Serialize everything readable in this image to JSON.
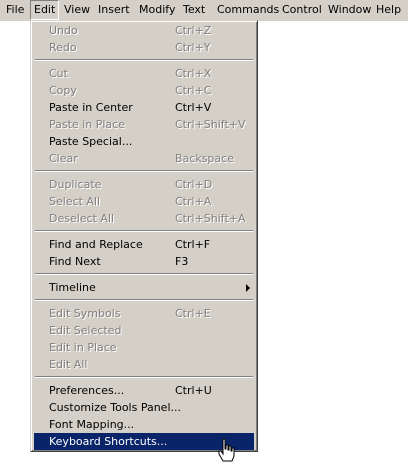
{
  "menubar": {
    "items": [
      "File",
      "Edit",
      "View",
      "Insert",
      "Modify",
      "Text",
      "Commands",
      "Control",
      "Window",
      "Help"
    ],
    "active": "Edit"
  },
  "edit_menu": {
    "undo": {
      "label": "Undo",
      "shortcut": "Ctrl+Z"
    },
    "redo": {
      "label": "Redo",
      "shortcut": "Ctrl+Y"
    },
    "cut": {
      "label": "Cut",
      "shortcut": "Ctrl+X"
    },
    "copy": {
      "label": "Copy",
      "shortcut": "Ctrl+C"
    },
    "paste_center": {
      "label": "Paste in Center",
      "shortcut": "Ctrl+V"
    },
    "paste_place": {
      "label": "Paste in Place",
      "shortcut": "Ctrl+Shift+V"
    },
    "paste_special": {
      "label": "Paste Special..."
    },
    "clear": {
      "label": "Clear",
      "shortcut": "Backspace"
    },
    "duplicate": {
      "label": "Duplicate",
      "shortcut": "Ctrl+D"
    },
    "select_all": {
      "label": "Select All",
      "shortcut": "Ctrl+A"
    },
    "deselect_all": {
      "label": "Deselect All",
      "shortcut": "Ctrl+Shift+A"
    },
    "find_replace": {
      "label": "Find and Replace",
      "shortcut": "Ctrl+F"
    },
    "find_next": {
      "label": "Find Next",
      "shortcut": "F3"
    },
    "timeline": {
      "label": "Timeline"
    },
    "edit_symbols": {
      "label": "Edit Symbols",
      "shortcut": "Ctrl+E"
    },
    "edit_selected": {
      "label": "Edit Selected"
    },
    "edit_in_place": {
      "label": "Edit in Place"
    },
    "edit_all": {
      "label": "Edit All"
    },
    "preferences": {
      "label": "Preferences...",
      "shortcut": "Ctrl+U"
    },
    "customize_tools": {
      "label": "Customize Tools Panel..."
    },
    "font_mapping": {
      "label": "Font Mapping..."
    },
    "keyboard_shortcuts": {
      "label": "Keyboard Shortcuts..."
    }
  },
  "colors": {
    "menu_bg": "#d4d0c8",
    "highlight": "#0a246a",
    "disabled_text": "#808080"
  },
  "icons": {
    "submenu": "triangle-right",
    "pointer": "hand-cursor"
  }
}
